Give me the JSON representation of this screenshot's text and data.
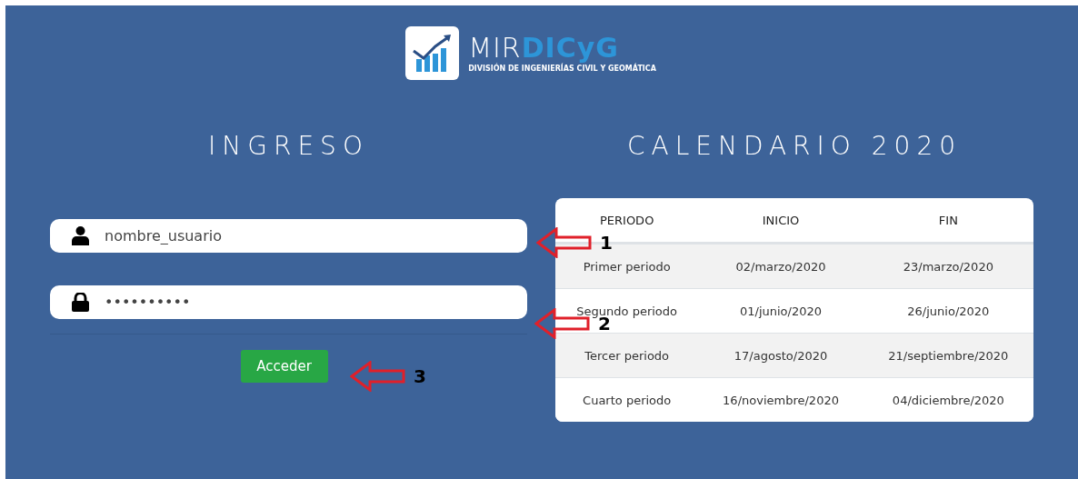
{
  "logo": {
    "name_light": "MIR",
    "name_bold": "DICyG",
    "subtitle": "DIVISIÓN DE INGENIERÍAS CIVIL Y GEOMÁTICA"
  },
  "login": {
    "title": "INGRESO",
    "fields": [
      {
        "kind": "user",
        "value": "nombre_usuario"
      },
      {
        "kind": "password",
        "value": "••••••••••"
      }
    ],
    "button": "Acceder"
  },
  "calendar": {
    "title": "CALENDARIO 2020",
    "columns": [
      "PERIODO",
      "INICIO",
      "FIN"
    ],
    "rows": [
      [
        "Primer periodo",
        "02/marzo/2020",
        "23/marzo/2020"
      ],
      [
        "Segundo periodo",
        "01/junio/2020",
        "26/junio/2020"
      ],
      [
        "Tercer periodo",
        "17/agosto/2020",
        "21/septiembre/2020"
      ],
      [
        "Cuarto periodo",
        "16/noviembre/2020",
        "04/diciembre/2020"
      ]
    ]
  },
  "annotations": [
    {
      "label": "1"
    },
    {
      "label": "2"
    },
    {
      "label": "3"
    }
  ]
}
